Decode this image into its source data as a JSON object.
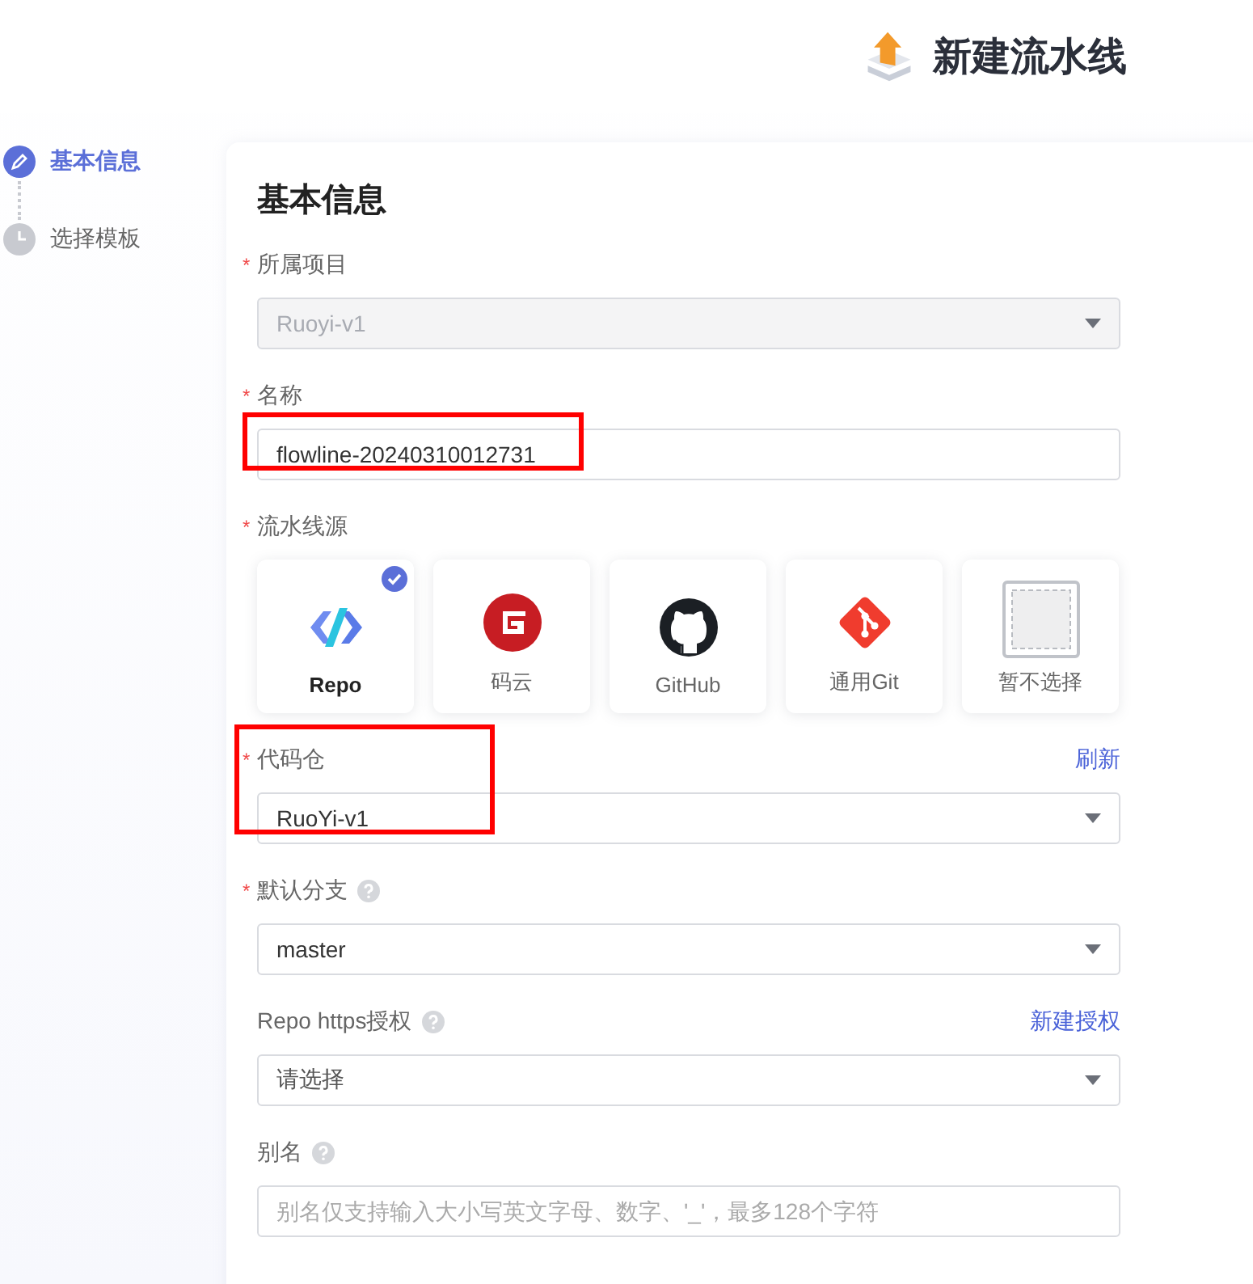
{
  "header": {
    "title": "新建流水线"
  },
  "steps": [
    {
      "label": "基本信息",
      "selected": true
    },
    {
      "label": "选择模板",
      "selected": false
    }
  ],
  "form": {
    "title": "基本信息",
    "fields": [
      {
        "kind": "select",
        "label": "所属项目",
        "required_mark": "*",
        "value": "Ruoyi-v1",
        "disabled": true
      },
      {
        "kind": "input",
        "label": "名称",
        "required_mark": "*",
        "value": "flowline-20240310012731",
        "highlighted": true
      },
      {
        "kind": "sources",
        "label": "流水线源",
        "required_mark": "*",
        "options": [
          {
            "label": "Repo",
            "selected": true
          },
          {
            "label": "码云",
            "selected": false
          },
          {
            "label": "GitHub",
            "selected": false
          },
          {
            "label": "通用Git",
            "selected": false
          },
          {
            "label": "暂不选择",
            "selected": false
          }
        ]
      },
      {
        "kind": "select",
        "label": "代码仓",
        "required_mark": "*",
        "value": "RuoYi-v1",
        "action": "刷新",
        "highlighted": true
      },
      {
        "kind": "select",
        "label": "默认分支",
        "required_mark": "*",
        "help": true,
        "value": "master"
      },
      {
        "kind": "select",
        "label": "Repo https授权",
        "help": true,
        "placeholder": "请选择",
        "action": "新建授权"
      },
      {
        "kind": "input",
        "label": "别名",
        "help": true,
        "placeholder": "别名仅支持输入大小写英文字母、数字、'_'，最多128个字符"
      }
    ]
  }
}
